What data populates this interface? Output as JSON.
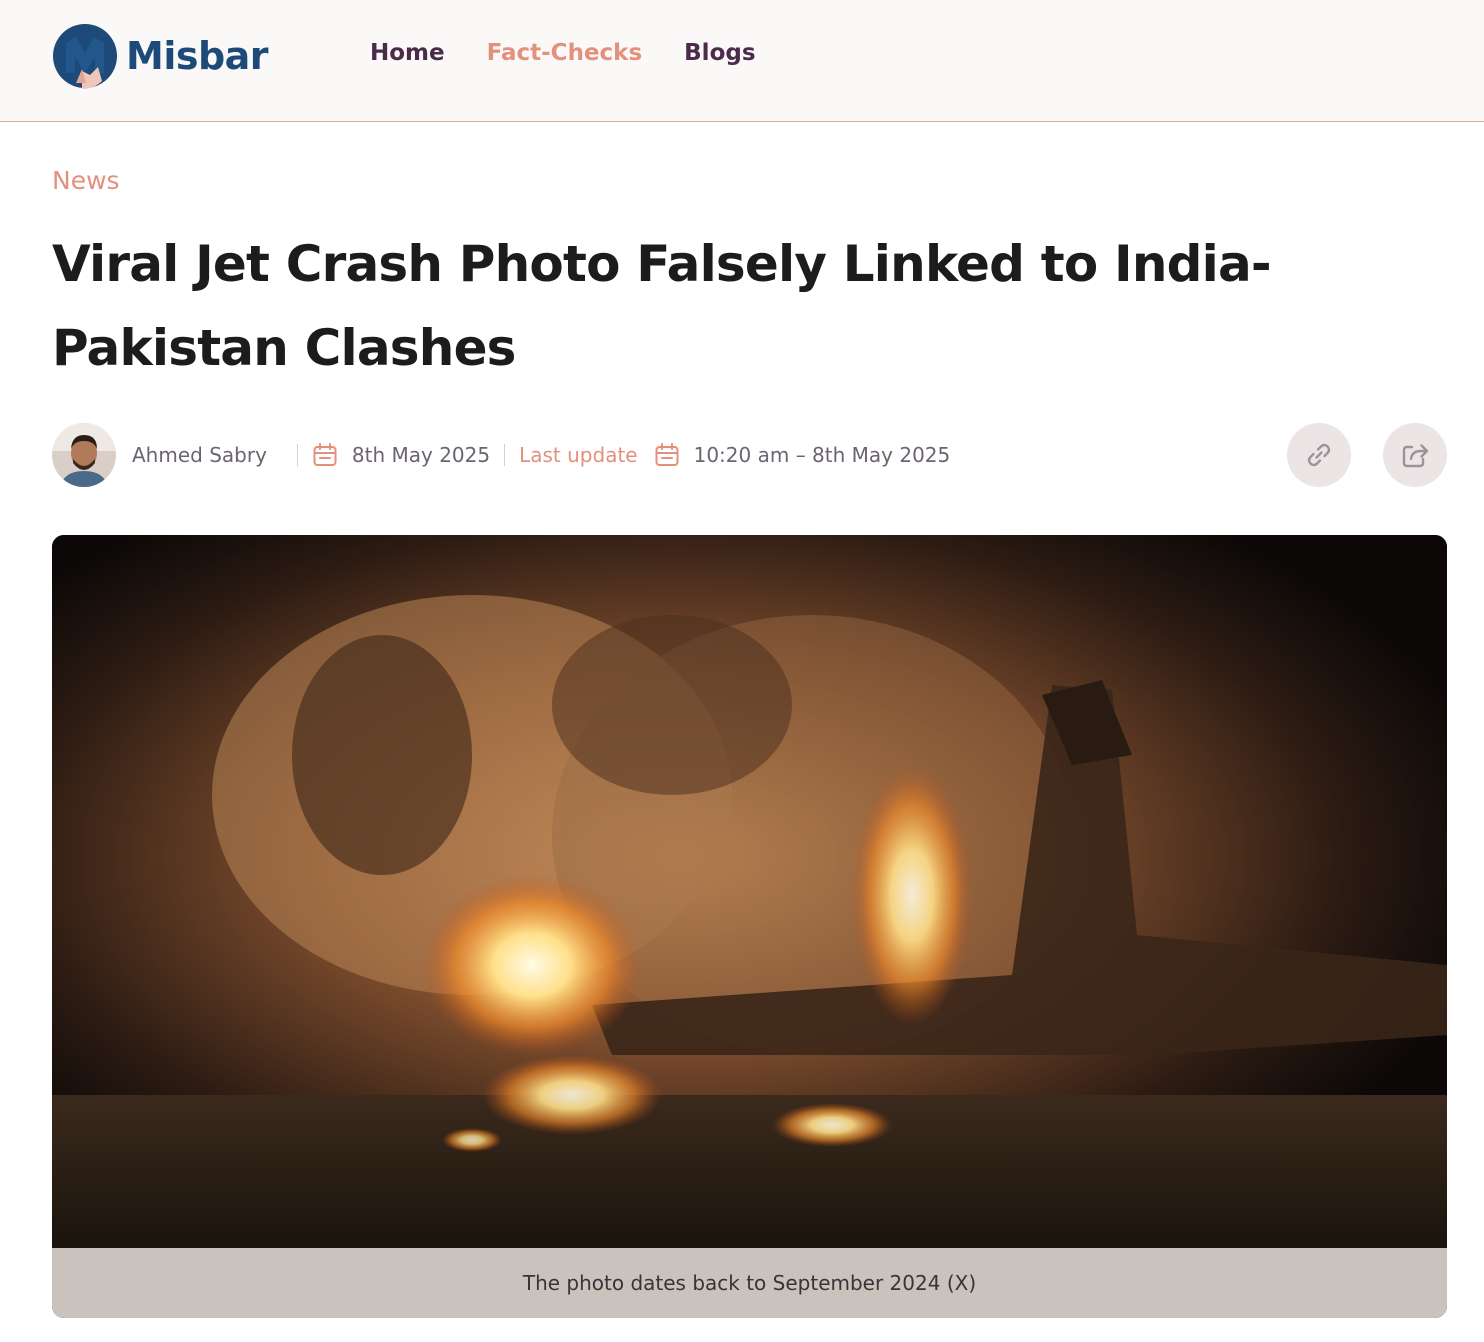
{
  "brand": {
    "name": "Misbar",
    "color": "#1d4a78",
    "accent": "#e3907c"
  },
  "nav": {
    "items": [
      {
        "label": "Home",
        "active": false
      },
      {
        "label": "Fact-Checks",
        "active": true
      },
      {
        "label": "Blogs",
        "active": false
      }
    ]
  },
  "article": {
    "category": "News",
    "title": "Viral Jet Crash Photo Falsely Linked to India-Pakistan Clashes",
    "author": "Ahmed Sabry",
    "published": "8th May 2025",
    "last_update_label": "Last update",
    "last_update": "10:20 am – 8th May 2025",
    "image_caption": "The photo dates back to September 2024 (X)"
  },
  "actions": {
    "copy_link_icon": "link-icon",
    "share_icon": "share-icon"
  }
}
